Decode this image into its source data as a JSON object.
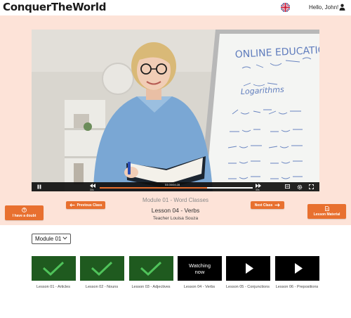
{
  "header": {
    "logo": "ConquerTheWorld",
    "greeting": "Hello, John!"
  },
  "video": {
    "time": "04:00/04:28",
    "skip_back": "30s",
    "skip_forward": "30s",
    "progress": 0.7
  },
  "lesson": {
    "module_name": "Module 01 - Word Classes",
    "lesson_name": "Lesson 04 - Verbs",
    "teacher": "Teacher Louisa Souza"
  },
  "buttons": {
    "previous": "Previous Class",
    "next": "Next Class",
    "doubt": "I have a doubt",
    "material": "Lesson Material"
  },
  "module_select": {
    "value": "Module 01"
  },
  "lessons": [
    {
      "label": "Lesson 01 - Articles",
      "state": "completed"
    },
    {
      "label": "Lesson 02 - Nouns",
      "state": "completed"
    },
    {
      "label": "Lesson 03 - Adjectives",
      "state": "completed"
    },
    {
      "label": "Lesson 04 - Verbs",
      "state": "current",
      "tile_text": "Watching now"
    },
    {
      "label": "Lesson 05 - Conjunctions",
      "state": "upcoming"
    },
    {
      "label": "Lesson 06 - Prepositions",
      "state": "upcoming"
    }
  ],
  "whiteboard": {
    "title": "ONLINE EDUCATION",
    "subtitle": "Logarithms"
  },
  "colors": {
    "accent": "#e8702f",
    "hero_bg": "#fde3d8",
    "completed": "#1f5a1f"
  }
}
